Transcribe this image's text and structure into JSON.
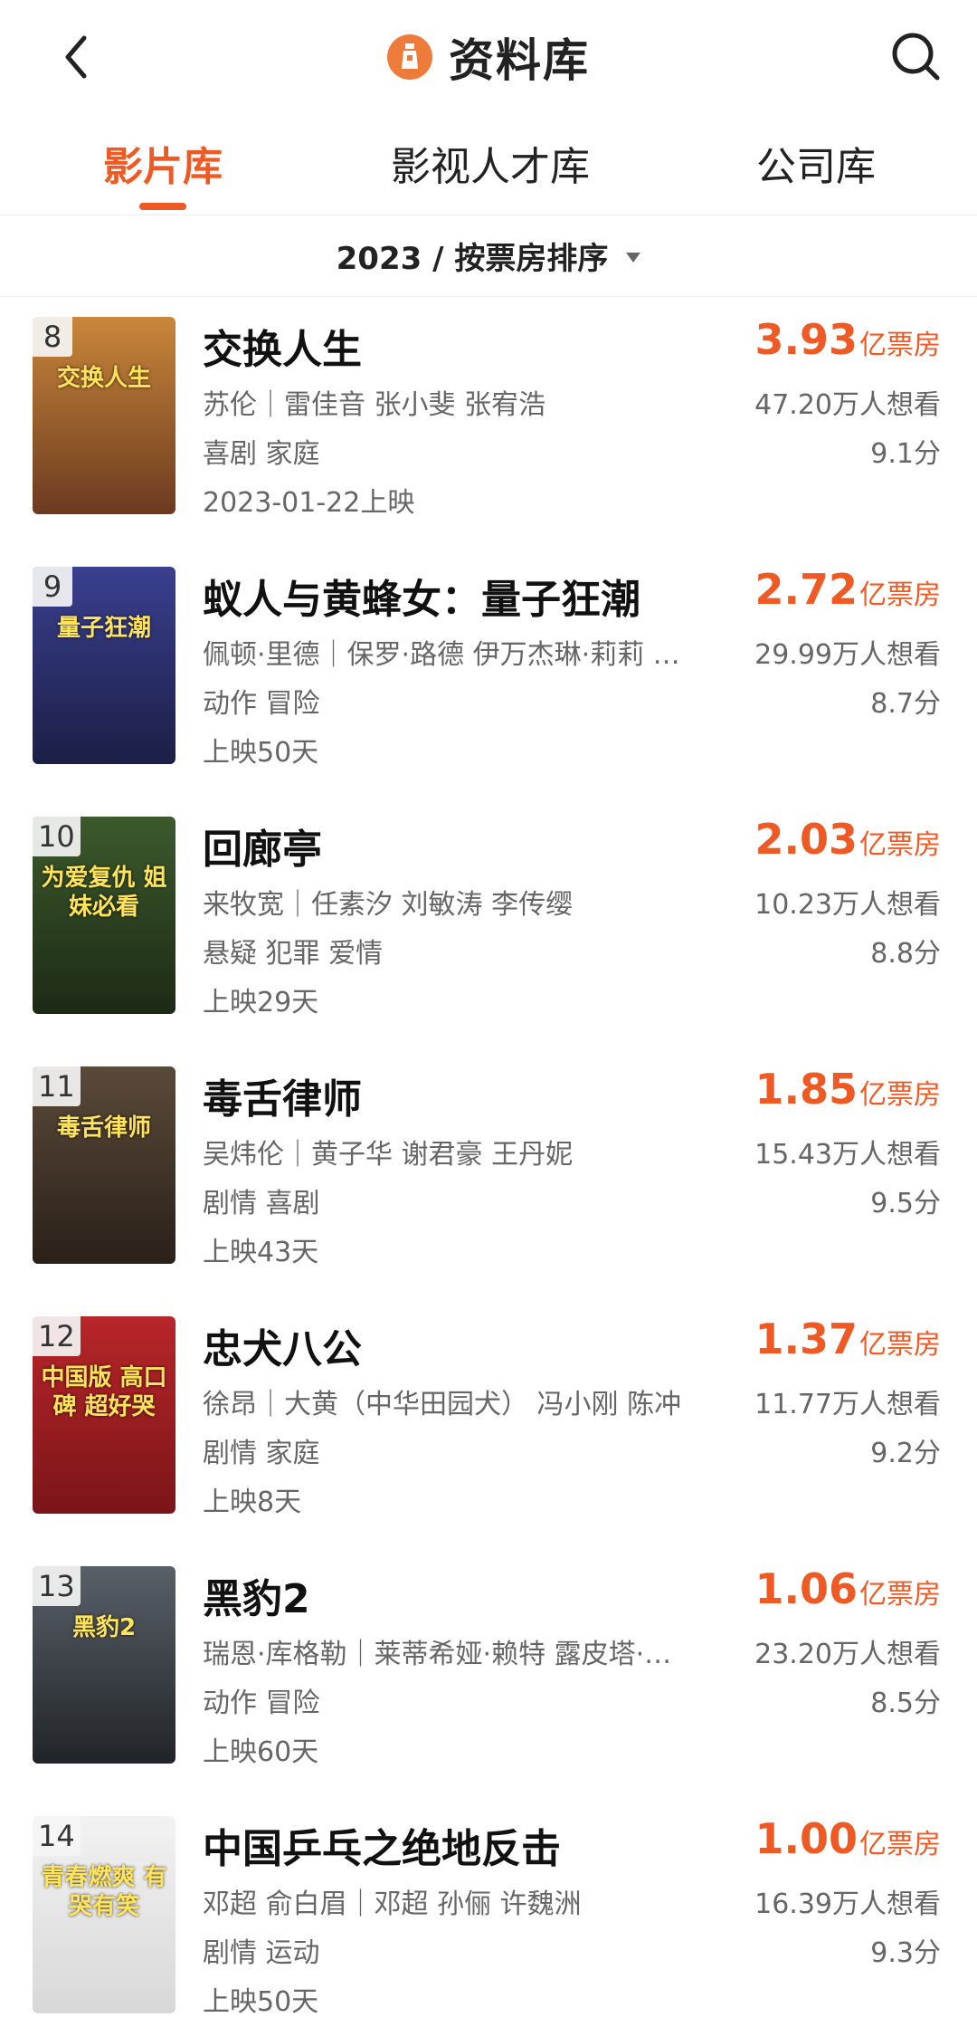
{
  "header": {
    "title": "资料库",
    "back_icon": "chevron-left-icon",
    "search_icon": "search-icon",
    "logo_icon": "lighthouse-logo-icon",
    "accent_color": "#ef5a24"
  },
  "tabs": [
    {
      "label": "影片库",
      "active": true
    },
    {
      "label": "影视人才库",
      "active": false
    },
    {
      "label": "公司库",
      "active": false
    }
  ],
  "sort": {
    "label": "2023 / 按票房排序",
    "icon": "triangle-down-icon"
  },
  "movies": [
    {
      "rank": "8",
      "title": "交换人生",
      "cast": "苏伦｜雷佳音 张小斐 张宥浩",
      "genre": "喜剧 家庭",
      "release": "2023-01-22上映",
      "box_value": "3.93",
      "box_unit": "亿票房",
      "wish": "47.20万人想看",
      "score": "9.1分",
      "poster_colors": [
        "#c9873a",
        "#6b3a20"
      ],
      "poster_text": "交换人生"
    },
    {
      "rank": "9",
      "title": "蚁人与黄蜂女：量子狂潮",
      "cast": "佩顿·里德｜保罗·路德 伊万杰琳·莉莉 …",
      "genre": "动作 冒险",
      "release": "上映50天",
      "box_value": "2.72",
      "box_unit": "亿票房",
      "wish": "29.99万人想看",
      "score": "8.7分",
      "poster_colors": [
        "#3a3f8f",
        "#1b1f45"
      ],
      "poster_text": "量子狂潮"
    },
    {
      "rank": "10",
      "title": "回廊亭",
      "cast": "来牧宽｜任素汐 刘敏涛 李传缨",
      "genre": "悬疑 犯罪 爱情",
      "release": "上映29天",
      "box_value": "2.03",
      "box_unit": "亿票房",
      "wish": "10.23万人想看",
      "score": "8.8分",
      "poster_colors": [
        "#3c5a2c",
        "#1d2a16"
      ],
      "poster_text": "为爱复仇 姐妹必看"
    },
    {
      "rank": "11",
      "title": "毒舌律师",
      "cast": "吴炜伦｜黄子华 谢君豪 王丹妮",
      "genre": "剧情 喜剧",
      "release": "上映43天",
      "box_value": "1.85",
      "box_unit": "亿票房",
      "wish": "15.43万人想看",
      "score": "9.5分",
      "poster_colors": [
        "#5a4a3a",
        "#2a2018"
      ],
      "poster_text": "毒舌律师"
    },
    {
      "rank": "12",
      "title": "忠犬八公",
      "cast": "徐昂｜大黄（中华田园犬） 冯小刚 陈冲",
      "genre": "剧情 家庭",
      "release": "上映8天",
      "box_value": "1.37",
      "box_unit": "亿票房",
      "wish": "11.77万人想看",
      "score": "9.2分",
      "poster_colors": [
        "#b8262a",
        "#7a1518"
      ],
      "poster_text": "中国版 高口碑 超好哭"
    },
    {
      "rank": "13",
      "title": "黑豹2",
      "cast": "瑞恩·库格勒｜莱蒂希娅·赖特 露皮塔·…",
      "genre": "动作 冒险",
      "release": "上映60天",
      "box_value": "1.06",
      "box_unit": "亿票房",
      "wish": "23.20万人想看",
      "score": "8.5分",
      "poster_colors": [
        "#5a6068",
        "#202428"
      ],
      "poster_text": "黑豹2"
    },
    {
      "rank": "14",
      "title": "中国乒乓之绝地反击",
      "cast": "邓超 俞白眉｜邓超 孙俪 许魏洲",
      "genre": "剧情 运动",
      "release": "上映50天",
      "box_value": "1.00",
      "box_unit": "亿票房",
      "wish": "16.39万人想看",
      "score": "9.3分",
      "poster_colors": [
        "#f2f2f2",
        "#d8d8d8"
      ],
      "poster_text": "青春燃爽 有哭有笑"
    }
  ]
}
